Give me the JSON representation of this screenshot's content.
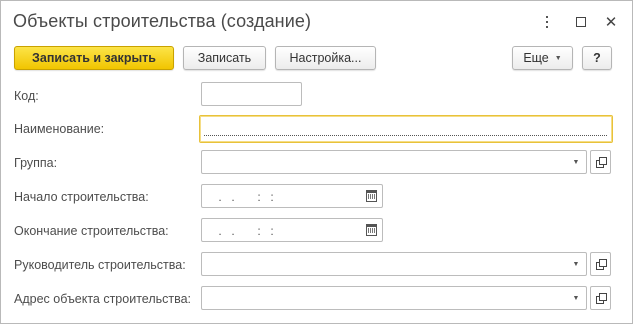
{
  "window": {
    "title": "Объекты строительства (создание)",
    "controls": [
      "kebab-icon",
      "maximize-icon",
      "close-icon"
    ]
  },
  "toolbar": {
    "save_close_label": "Записать и закрыть",
    "save_label": "Записать",
    "settings_label": "Настройка...",
    "more_label": "Еще",
    "help_label": "?"
  },
  "form": {
    "code_label": "Код:",
    "code_value": "",
    "name_label": "Наименование:",
    "name_value": "",
    "group_label": "Группа:",
    "group_value": "",
    "start_label": "Начало строительства:",
    "start_mask": " .  .     :  :",
    "end_label": "Окончание строительства:",
    "end_mask": " .  .     :  :",
    "manager_label": "Руководитель строительства:",
    "manager_value": "",
    "address_label": "Адрес объекта строительства:",
    "address_value": ""
  },
  "colors": {
    "primary_button": "#f5d40f",
    "focus_border": "#e8c23a",
    "field_border": "#bcbcbc"
  }
}
